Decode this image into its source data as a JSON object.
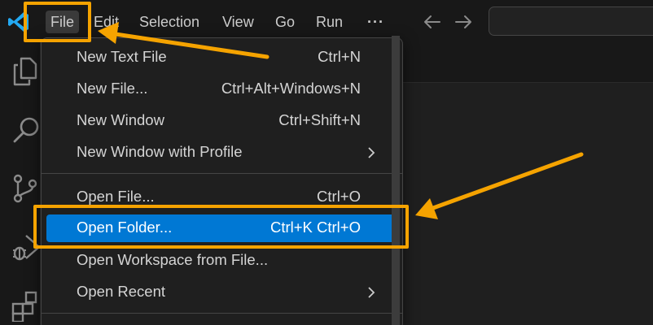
{
  "menubar": {
    "items": [
      {
        "label": "File"
      },
      {
        "label": "Edit"
      },
      {
        "label": "Selection"
      },
      {
        "label": "View"
      },
      {
        "label": "Go"
      },
      {
        "label": "Run"
      },
      {
        "label": "···"
      }
    ]
  },
  "file_menu": {
    "items": [
      {
        "label": "New Text File",
        "shortcut": "Ctrl+N"
      },
      {
        "label": "New File...",
        "shortcut": "Ctrl+Alt+Windows+N"
      },
      {
        "label": "New Window",
        "shortcut": "Ctrl+Shift+N"
      },
      {
        "label": "New Window with Profile",
        "shortcut": ""
      },
      {
        "label": "Open File...",
        "shortcut": "Ctrl+O"
      },
      {
        "label": "Open Folder...",
        "shortcut": "Ctrl+K Ctrl+O"
      },
      {
        "label": "Open Workspace from File...",
        "shortcut": ""
      },
      {
        "label": "Open Recent",
        "shortcut": ""
      }
    ]
  },
  "colors": {
    "accent": "#0078d4",
    "annotation": "#f5a300",
    "logo": "#23a9f2"
  },
  "icons": [
    "vscode-logo-icon",
    "back-arrow-icon",
    "forward-arrow-icon",
    "explorer-icon",
    "search-icon",
    "source-control-icon",
    "run-debug-icon",
    "extensions-icon",
    "chevron-right-icon"
  ]
}
